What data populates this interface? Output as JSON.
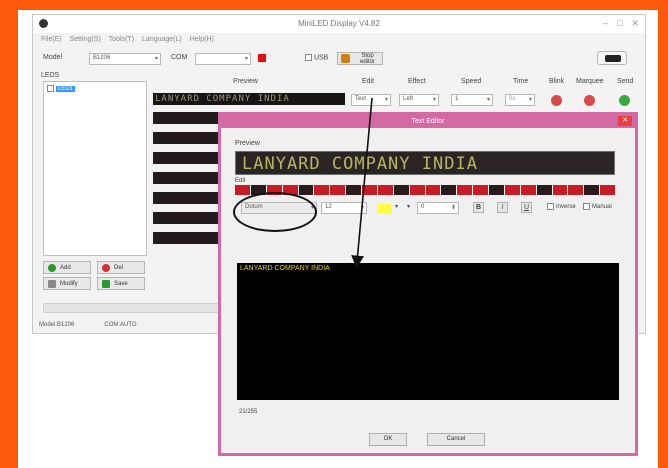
{
  "window": {
    "title": "MiniLED Display V4.82",
    "controls": [
      "–",
      "□",
      "✕"
    ]
  },
  "menu": [
    "File(E)",
    "Setting(S)",
    "Tools(T)",
    "Language(L)",
    "Help(H)"
  ],
  "toolbar": {
    "model_label": "Model",
    "model_value": "B1206",
    "com_label": "COM",
    "usb_label": "USB",
    "stop_button": "Stop editor",
    "port_color": "#e01010"
  },
  "leds": {
    "label": "LEDS",
    "item": "LED1"
  },
  "columns": [
    "Preview",
    "Edit",
    "Effect",
    "Speed",
    "Time",
    "Blink",
    "Marquee",
    "Send"
  ],
  "row1": {
    "preview_text": "LANYARD COMPANY INDIA",
    "edit_button": "Text",
    "effect_value": "Left",
    "speed_value": "1",
    "time_value": "0s"
  },
  "side_buttons": [
    {
      "icon": "add-icon",
      "label": "Add",
      "color": "#2a9a2a"
    },
    {
      "icon": "delete-icon",
      "label": "Del",
      "color": "#d83030"
    },
    {
      "icon": "modify-icon",
      "label": "Modify",
      "color": "#666666"
    },
    {
      "icon": "save-icon",
      "label": "Save",
      "color": "#2a9a2a"
    }
  ],
  "status": {
    "model": "Model:B1206",
    "com": "COM:AUTO"
  },
  "dialog": {
    "title": "Text Editor",
    "preview_label": "Preview",
    "preview_text": "LANYARD COMPANY INDIA",
    "edit_label": "Edit",
    "font_value": "Dotum",
    "size_value": "12",
    "offset_value": "0",
    "bold_label": "B",
    "italic_label": "I",
    "underline_label": "U",
    "inverse_label": "Inverse",
    "manual_label": "Manual",
    "text_color": "#ffff40",
    "editor_text": "LANYARD COMPANY INDIA",
    "char_count": "21/255",
    "ok_button": "OK",
    "cancel_button": "Cancel"
  }
}
